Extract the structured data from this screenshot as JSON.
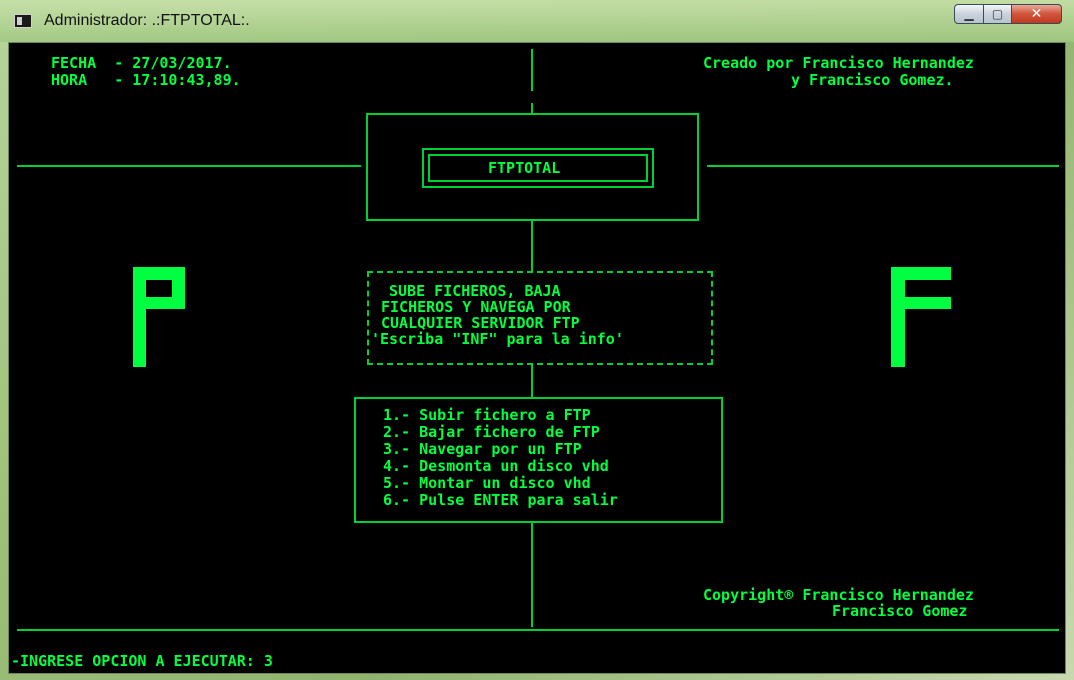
{
  "window": {
    "title": "Administrador:  .:FTPTOTAL:.",
    "minimize_icon": "minimize-icon",
    "maximize_icon": "maximize-icon",
    "close_icon": "close-icon"
  },
  "header": {
    "date_line": "FECHA  - 27/03/2017.",
    "time_line": "HORA   - 17:10:43,89.",
    "credit_line1": "Creado por Francisco Hernandez",
    "credit_line2": "y Francisco Gomez."
  },
  "logo": {
    "title": "FTPTOTAL",
    "left_letter": "P",
    "right_letter": "F"
  },
  "info_box": {
    "lines": [
      "SUBE FICHEROS, BAJA",
      "FICHEROS Y NAVEGA POR",
      "CUALQUIER SERVIDOR FTP",
      "'Escriba \"INF\" para la info'"
    ]
  },
  "menu": {
    "items": [
      "1.- Subir fichero a FTP",
      "2.- Bajar fichero de FTP",
      "3.- Navegar por un FTP",
      "4.- Desmonta un disco vhd",
      "5.- Montar un disco vhd",
      "6.- Pulse ENTER para salir"
    ]
  },
  "footer": {
    "copyright_line1": "Copyright® Francisco Hernandez",
    "copyright_line2": "Francisco Gomez"
  },
  "prompt": {
    "text": "-INGRESE OPCION A EJECUTAR: 3"
  },
  "colors": {
    "foreground": "#00ff40",
    "background": "#000000"
  }
}
